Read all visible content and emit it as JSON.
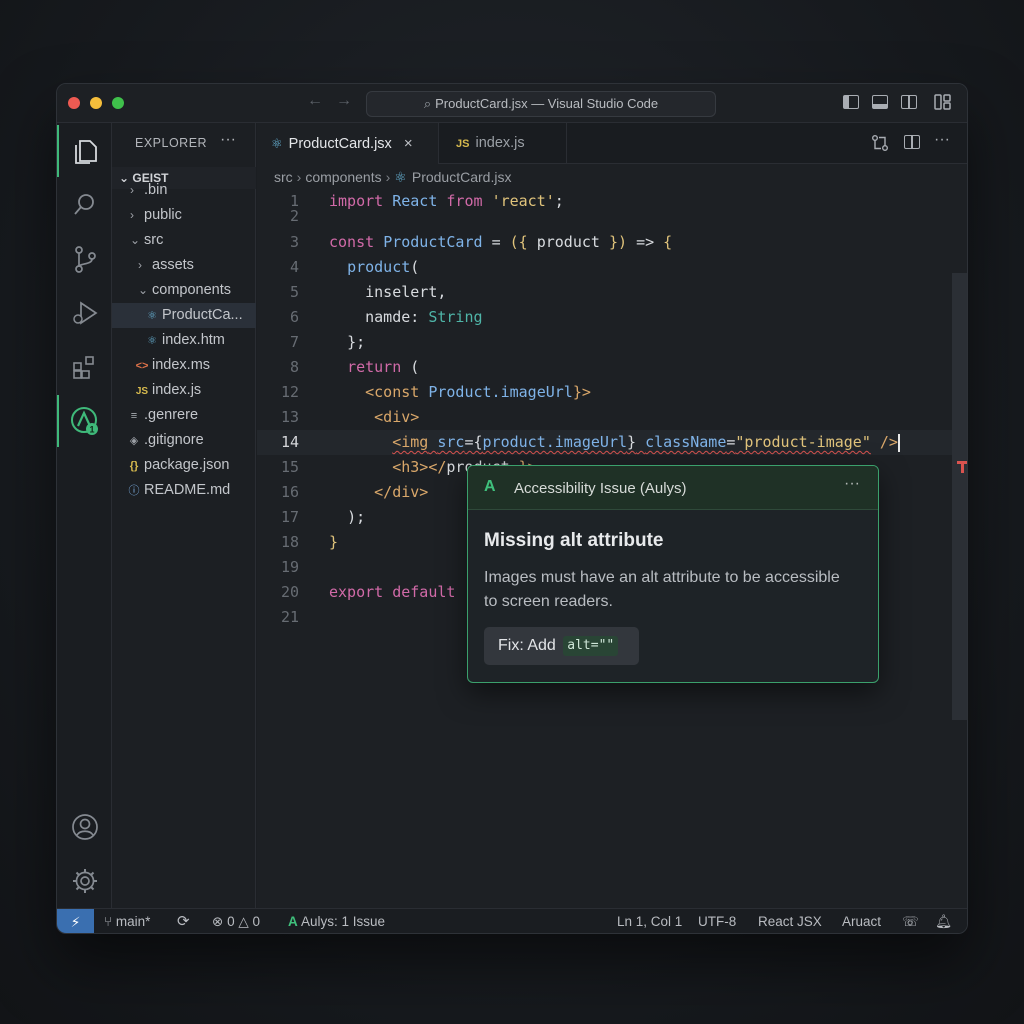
{
  "window": {
    "title": "ProductCard.jsx — Visual Studio Code"
  },
  "explorer": {
    "title": "EXPLORER",
    "more": "···",
    "section": "GEIST",
    "items": [
      {
        "label": ".bin",
        "chevron": "›",
        "icon": ""
      },
      {
        "label": "public",
        "chevron": "›",
        "icon": ""
      },
      {
        "label": "src",
        "chevron": "⌄",
        "icon": ""
      },
      {
        "label": "assets",
        "chevron": "›",
        "icon": ""
      },
      {
        "label": "components",
        "chevron": "⌄",
        "icon": ""
      },
      {
        "label": "ProductCa...",
        "chevron": "",
        "icon": "react-icon"
      },
      {
        "label": "index.htm",
        "chevron": "",
        "icon": "react-icon"
      },
      {
        "label": "index.ms",
        "chevron": "",
        "icon": "html-icon"
      },
      {
        "label": "index.js",
        "chevron": "",
        "icon": "js-icon"
      },
      {
        "label": ".genrere",
        "chevron": "",
        "icon": "lines-icon"
      },
      {
        "label": ".gitignore",
        "chevron": "",
        "icon": "git-icon"
      },
      {
        "label": "package.json",
        "chevron": "",
        "icon": "json-icon"
      },
      {
        "label": "README.md",
        "chevron": "",
        "icon": "info-icon"
      }
    ]
  },
  "tabs": [
    {
      "label": "ProductCard.jsx",
      "active": true,
      "close": "×"
    },
    {
      "label": "index.js",
      "active": false,
      "badge": "JS"
    }
  ],
  "breadcrumb": {
    "parts": [
      "src",
      "components",
      "ProductCard.jsx"
    ]
  },
  "code": {
    "line_numbers": [
      "1",
      "2",
      "3",
      "4",
      "5",
      "6",
      "7",
      "8",
      "12",
      "13",
      "14",
      "15",
      "16",
      "17",
      "18",
      "19",
      "20",
      "21"
    ],
    "current_line": "14"
  },
  "popup": {
    "header": "Accessibility Issue (Aulys)",
    "logo": "A",
    "more": "···",
    "title": "Missing alt attribute",
    "description": "Images must have an alt attribute to be accessible to screen readers.",
    "fix_label": "Fix: Add",
    "fix_code": "alt=\"\""
  },
  "status": {
    "branch": "main*",
    "errors": "0",
    "warnings": "0",
    "aulys": "Aulys: 1 Issue",
    "position": "Ln 1, Col 1",
    "encoding": "UTF-8",
    "language": "React JSX",
    "extra": "Aruact"
  },
  "colors": {
    "accent_green": "#3fb97a",
    "remote_blue": "#3a6fb0",
    "error_red": "#d9534f"
  }
}
